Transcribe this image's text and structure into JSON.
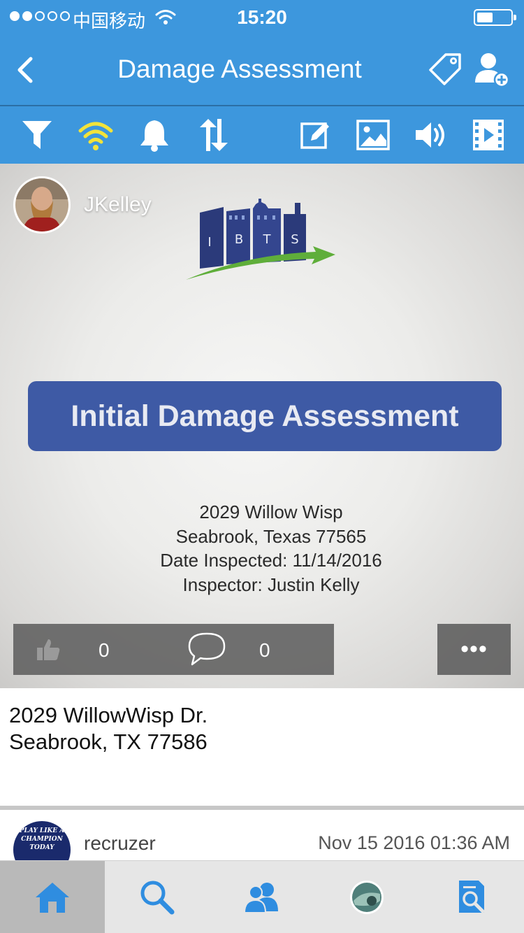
{
  "status_bar": {
    "carrier": "中国移动",
    "time": "15:20"
  },
  "nav": {
    "title": "Damage Assessment"
  },
  "toolbar": {
    "icons": [
      "filter-icon",
      "wifi-icon",
      "bell-icon",
      "sort-icon",
      "edit-icon",
      "image-icon",
      "speaker-icon",
      "video-icon"
    ],
    "wifi_color": "#f2e33a"
  },
  "post": {
    "author": "JKelley",
    "image": {
      "logo_letters": [
        "I",
        "B",
        "T",
        "S"
      ],
      "banner": "Initial Damage Assessment",
      "lines": [
        "2029 Willow Wisp",
        "Seabrook, Texas 77565",
        "Date Inspected: 11/14/2016",
        "Inspector: Justin Kelly"
      ]
    },
    "likes": "0",
    "comments": "0",
    "more_label": "•••",
    "caption_line1": "2029 WillowWisp Dr.",
    "caption_line2": "Seabrook, TX 77586"
  },
  "next_post": {
    "author": "recruzer",
    "timestamp": "Nov 15 2016 01:36 AM",
    "avatar_text": "PLAY LIKE A CHAMPION TODAY"
  },
  "tab_bar": {
    "tabs": [
      "home",
      "search",
      "people",
      "profile",
      "document-search"
    ],
    "active": "home"
  },
  "colors": {
    "primary": "#3d97dd",
    "icon_blue": "#2f8de0",
    "banner": "#3e5aa5"
  }
}
